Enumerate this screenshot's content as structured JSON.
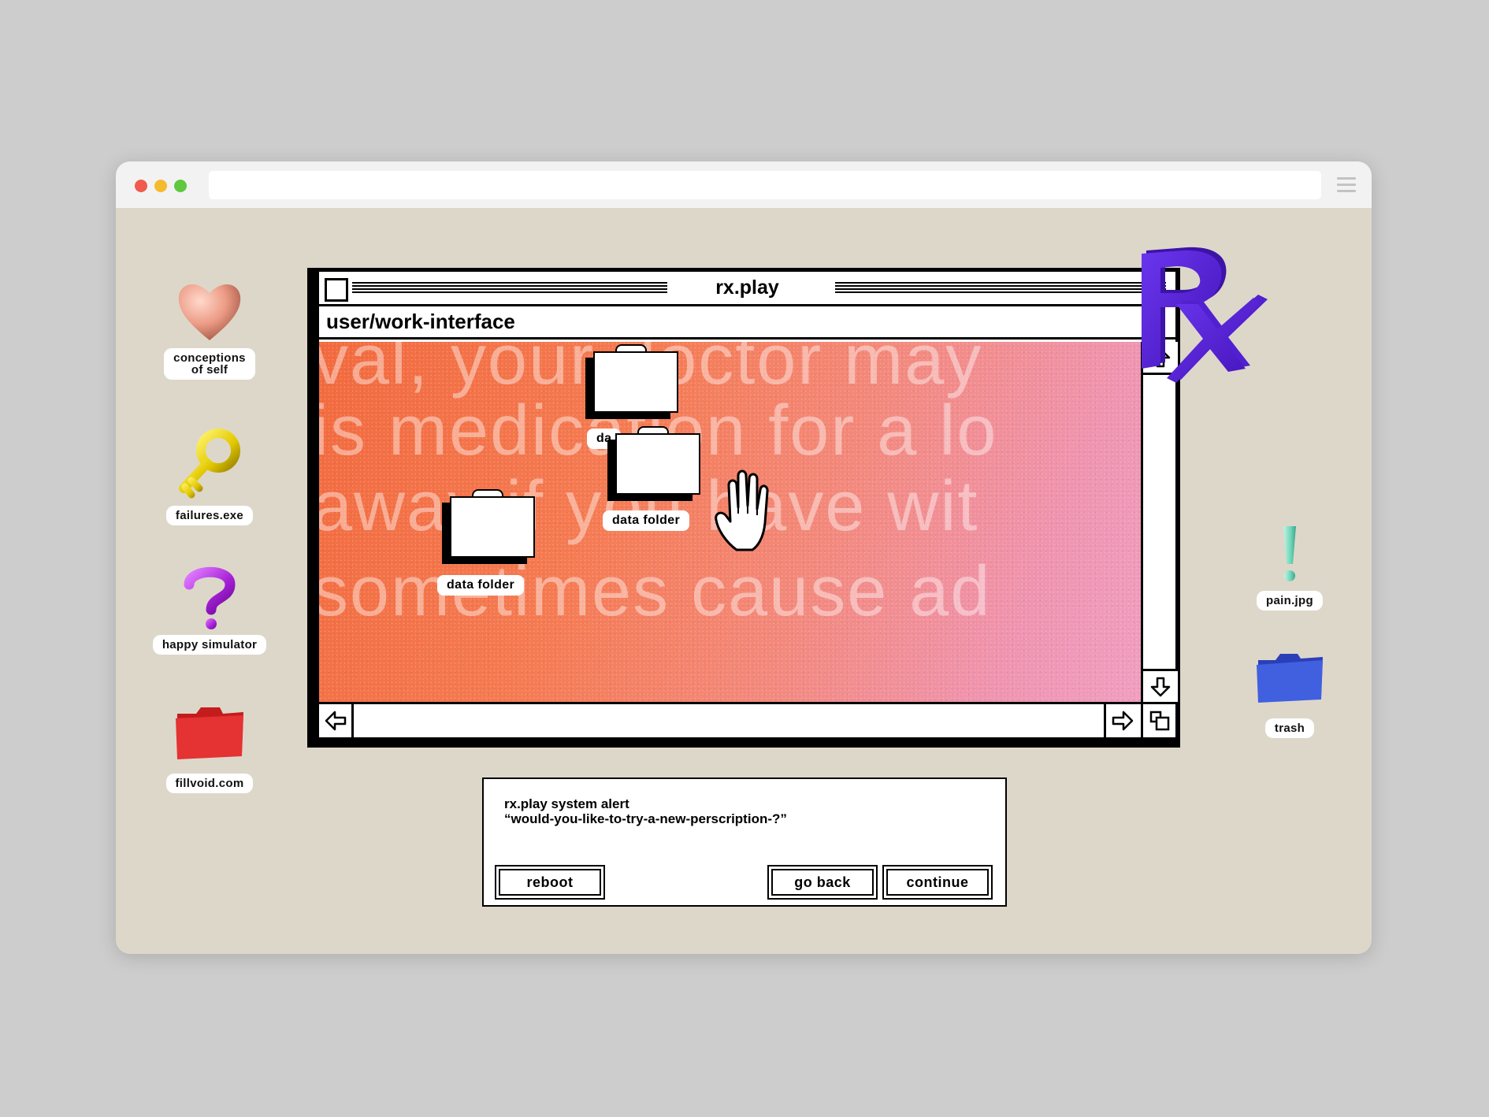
{
  "desktop_icons": {
    "left": [
      {
        "label_line1": "conceptions",
        "label_line2": "of self",
        "icon": "heart-icon"
      },
      {
        "label": "failures.exe",
        "icon": "key-icon"
      },
      {
        "label": "happy simulator",
        "icon": "question-mark-icon"
      },
      {
        "label": "fillvoid.com",
        "icon": "red-folder-icon"
      }
    ],
    "right": [
      {
        "label": "pain.jpg",
        "icon": "exclamation-icon"
      },
      {
        "label": "trash",
        "icon": "blue-folder-icon"
      }
    ]
  },
  "window": {
    "title": "rx.play",
    "path": "user/work-interface",
    "background_lines": [
      "val, your doctor may",
      "is medication for a lo",
      "away if you have wit",
      "sometimes cause ad"
    ],
    "folders": [
      {
        "label": "da",
        "hint": "data folder (partially covered)"
      },
      {
        "label": "data folder"
      },
      {
        "label": "data folder"
      }
    ]
  },
  "logo": {
    "text": "Rx",
    "color": "#5a1fd6"
  },
  "dialog": {
    "title": "rx.play system alert",
    "message": "“would-you-like-to-try-a-new-perscription-?”",
    "buttons": {
      "reboot": "reboot",
      "go_back": "go back",
      "continue": "continue"
    }
  },
  "colors": {
    "accent_gradient_start": "#f26a3e",
    "accent_gradient_end": "#f09ec0",
    "desktop": "#ddd7ca"
  }
}
